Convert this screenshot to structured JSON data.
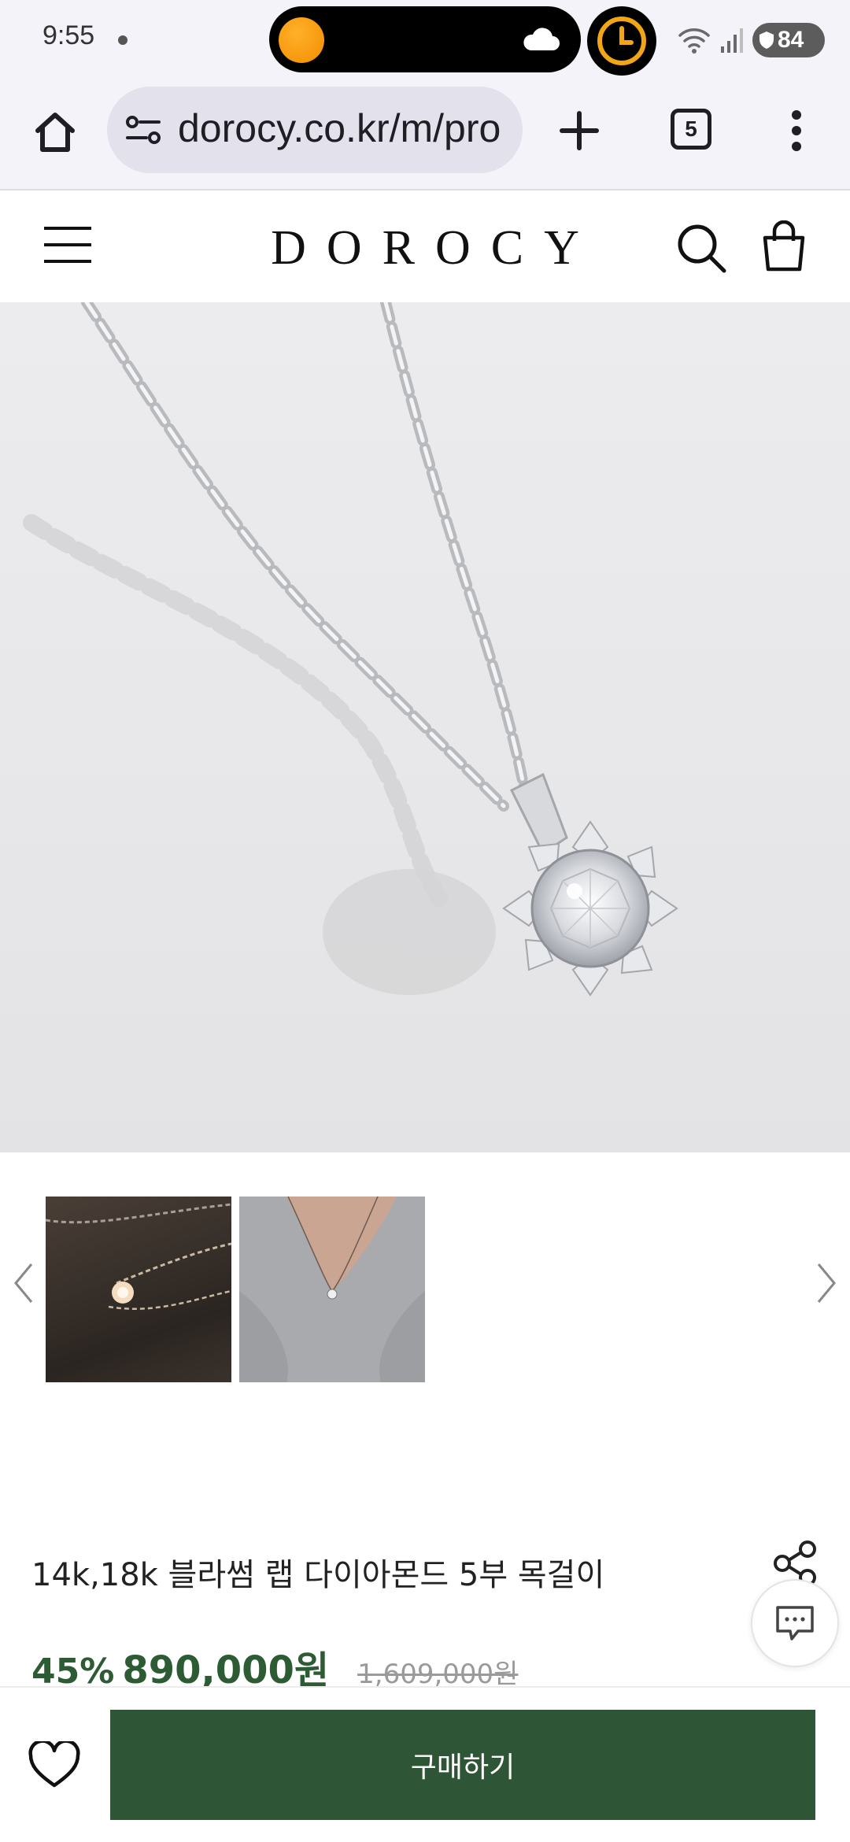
{
  "status_bar": {
    "time": "9:55",
    "battery": "84"
  },
  "browser": {
    "url": "dorocy.co.kr/m/pro",
    "tab_count": "5"
  },
  "shop": {
    "logo": "DOROCY"
  },
  "product": {
    "name": "14k,18k 블라썸 랩 다이아몬드 5부 목걸이",
    "discount": "45%",
    "price": "890,000원",
    "original_price": "1,609,000원"
  },
  "actions": {
    "buy_label": "구매하기"
  },
  "colors": {
    "accent_green": "#2d5536",
    "price_green": "#2d5c34"
  }
}
